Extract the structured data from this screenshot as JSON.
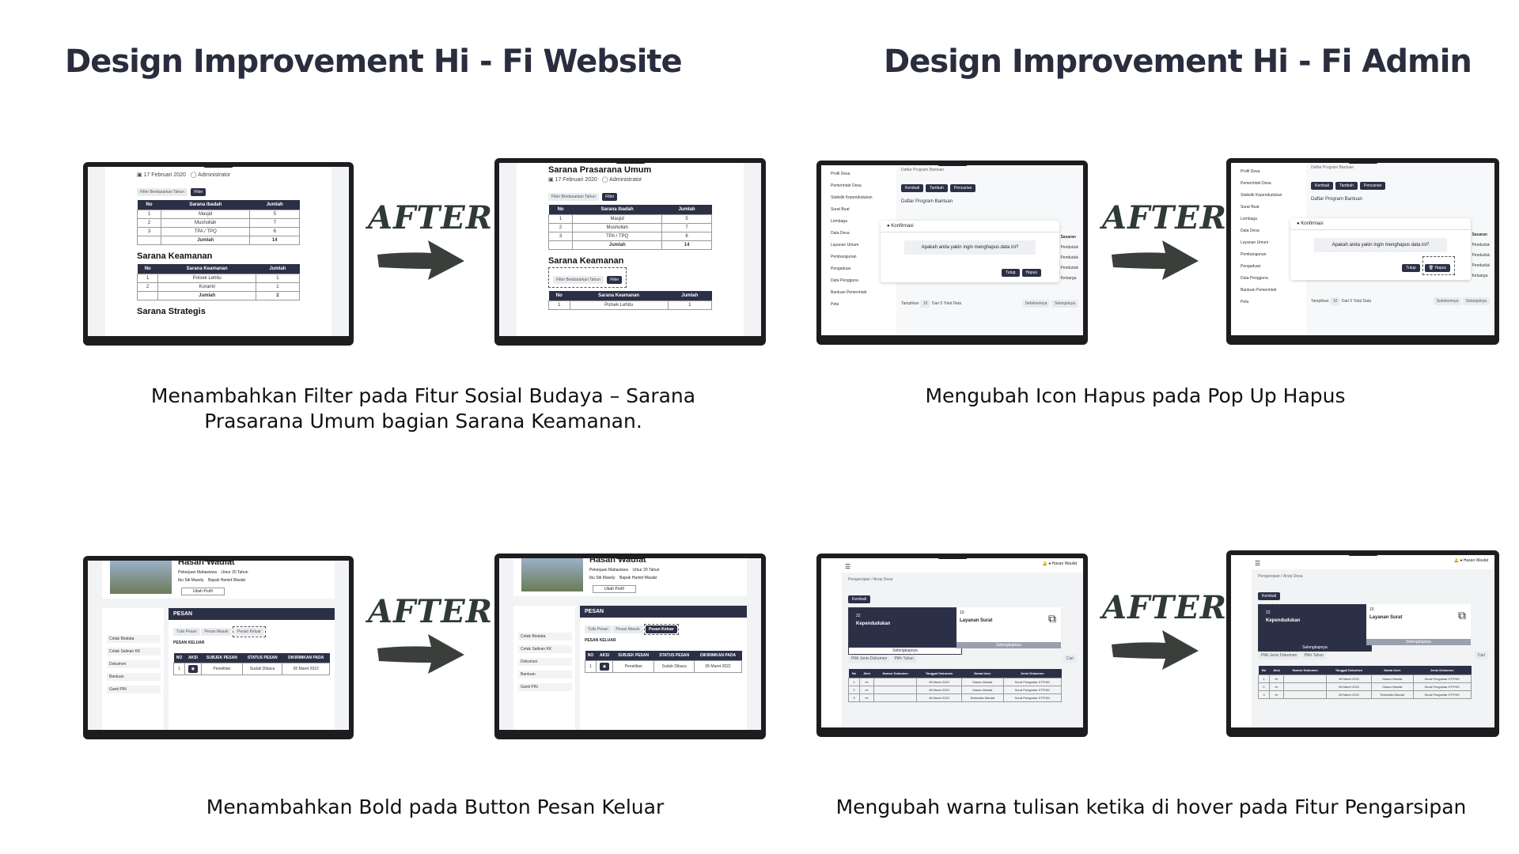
{
  "headings": {
    "website": "Design Improvement Hi - Fi Website",
    "admin": "Design Improvement Hi - Fi Admin"
  },
  "after_label": "AFTER",
  "captions": {
    "filter": "Menambahkan Filter pada Fitur Sosial Budaya – Sarana Prasarana Umum bagian Sarana Keamanan.",
    "hapus": "Mengubah Icon Hapus pada Pop Up Hapus",
    "bold": "Menambahkan Bold pada Button Pesan Keluar",
    "hover": "Mengubah warna tulisan ketika di hover pada Fitur Pengarsipan"
  },
  "website_screen": {
    "page_title": "Sarana Prasarana Umum",
    "date": "17 Februari 2020",
    "author": "Administrator",
    "filter_placeholder": "Filter Berdasarkan Tahun",
    "filter_button": "Filter",
    "ibadah_headers": [
      "No",
      "Sarana Ibadah",
      "Jumlah"
    ],
    "ibadah_rows": [
      [
        "1",
        "Masjid",
        "5"
      ],
      [
        "2",
        "Mushollah",
        "7"
      ],
      [
        "3",
        "TPA / TPQ",
        "6"
      ]
    ],
    "total_label": "Jumlah",
    "ibadah_total": "14",
    "keamanan_title": "Sarana Keamanan",
    "keamanan_headers": [
      "No",
      "Sarana Keamanan",
      "Jumlah"
    ],
    "keamanan_rows": [
      [
        "1",
        "Polsek Lehitu",
        "1"
      ],
      [
        "2",
        "Koramil",
        "1"
      ]
    ],
    "keamanan_total": "2",
    "next_section": "Sarana Strategis"
  },
  "admin_screen": {
    "sidebar": [
      "Profil Desa",
      "Pemerintah Desa",
      "Statistik Kependudukan",
      "Surat Buat",
      "Lembaga",
      "Data Desa",
      "Layanan Umum",
      "Pembangunan",
      "Pengaduan",
      "Data Pengguna",
      "Bantuan Pemerintah",
      "Peta"
    ],
    "breadcrumb": "Daftar Program Bantuan",
    "buttons": [
      "Kembali",
      "Tambah",
      "Pencarian"
    ],
    "list_title": "Daftar Program Bantuan",
    "modal_title": "Konfirmasi",
    "modal_text": "Apakah anda yakin ingin menghapus data ini?",
    "modal_cancel": "Tutup",
    "modal_delete": "Hapus",
    "side_col": "Sasaran",
    "side_values": [
      "Penduduk",
      "Penduduk",
      "Penduduk",
      "Keluarga"
    ],
    "page_label": "Tampilkan",
    "page_size": "10",
    "page_info": "Dari 5 Total Data",
    "prev": "Sebelumnya",
    "next": "Selanjutnya"
  },
  "profile_screen": {
    "name": "Hasan Waulat",
    "occupation_label": "Pekerjaan",
    "occupation": "Mahasiswa",
    "age_label": "Umur",
    "age": "20 Tahun",
    "mother_label": "Ibu",
    "mother": "Siti Masely",
    "father_label": "Bapak",
    "father": "Hamid Waulat",
    "profile_button": "Ubah Profil",
    "menu": [
      "Cetak Biodata",
      "Cetak Salinan KK",
      "Dokumen",
      "Bantuan",
      "Ganti PIN"
    ],
    "panel_title": "PESAN",
    "tabs": [
      "Tulis Pesan",
      "Pesan Masuk",
      "Pesan Keluar"
    ],
    "section": "PESAN KELUAR",
    "headers": [
      "NO",
      "AKSI",
      "SUBJEK PESAN",
      "STATUS PESAN",
      "DIKIRIMKAN PADA"
    ],
    "row": [
      "1",
      "",
      "Penelitian",
      "Sudah Dibaca",
      "05 Maret 2022"
    ]
  },
  "arsip_screen": {
    "user": "Hasan Waulat",
    "breadcrumb": "Pengarsipan / Arsip Desa",
    "back": "Kembali",
    "card1_count": "22",
    "card1_label": "Kependudukan",
    "card2_count": "10",
    "card2_label": "Layanan Surat",
    "card_link": "Selengkapnya",
    "filter1": "Pilih Jenis Dokumen",
    "filter2": "Pilih Tahun",
    "search": "Cari",
    "headers": [
      "No",
      "Aksi",
      "Nomor Dokumen",
      "Tanggal Dokumen",
      "Nama User",
      "Jenis Dokumen"
    ],
    "rows": [
      [
        "1",
        "",
        "",
        "08 Maret 2022",
        "Hasan Waulat",
        "Surat Pengantar KTP/KK"
      ],
      [
        "2",
        "",
        "",
        "08 Maret 2022",
        "Hasan Waulat",
        "Surat Pengantar KTP/KK"
      ],
      [
        "3",
        "",
        "",
        "08 Maret 2022",
        "Rahmalia Waulat",
        "Surat Pengantar KTP/KK"
      ]
    ]
  }
}
